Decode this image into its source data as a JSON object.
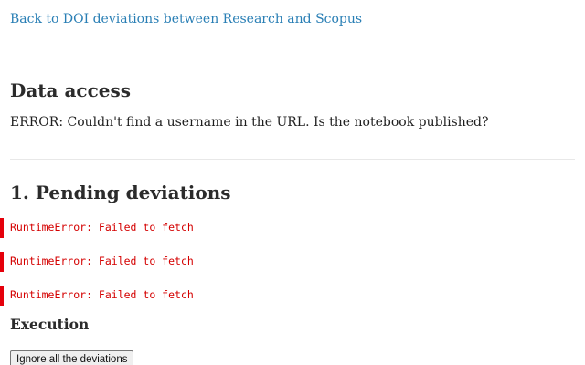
{
  "nav": {
    "back_link": "Back to DOI deviations between Research and Scopus"
  },
  "data_access": {
    "heading": "Data access",
    "message": "ERROR: Couldn't find a username in the URL. Is the notebook published?"
  },
  "pending": {
    "heading": "1. Pending deviations",
    "errors": [
      "RuntimeError: Failed to fetch",
      "RuntimeError: Failed to fetch",
      "RuntimeError: Failed to fetch"
    ]
  },
  "execution": {
    "heading": "Execution",
    "button_label": "Ignore all the deviations"
  },
  "colors": {
    "link": "#2a7fb5",
    "error_text": "#d40000",
    "error_bar": "#e5000b"
  }
}
